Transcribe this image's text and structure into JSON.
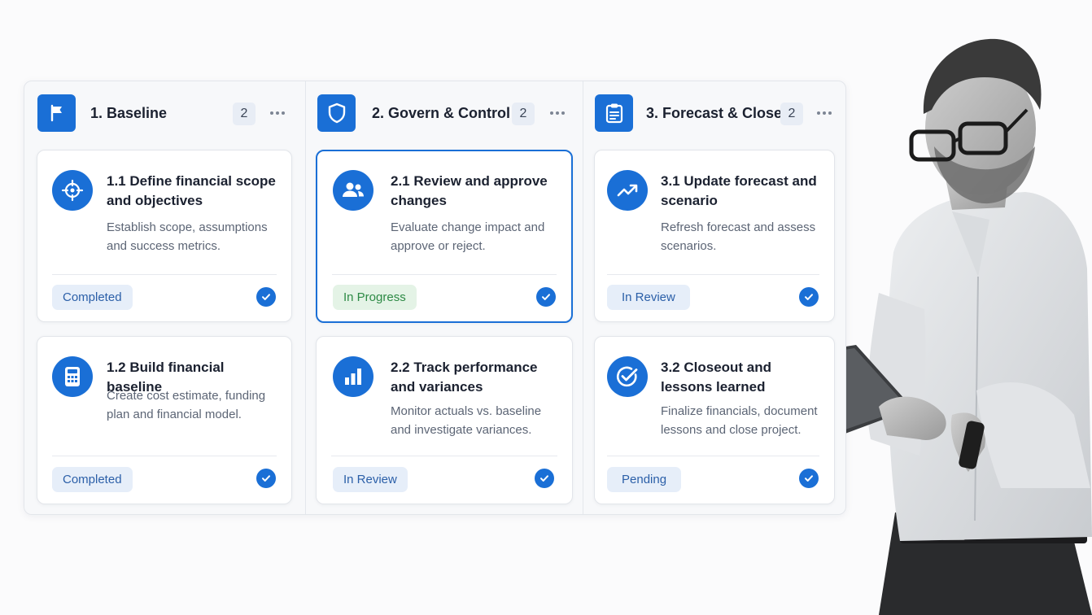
{
  "columns": [
    {
      "title": "1. Baseline",
      "count": "2",
      "icon": "flag-icon",
      "cards": [
        {
          "title": "1.1 Define financial scope and objectives",
          "description": "Establish scope, assumptions and success metrics.",
          "status": "Completed",
          "icon": "target-icon"
        },
        {
          "title": "1.2 Build financial baseline",
          "description": "Create cost estimate, funding plan and financial model.",
          "status": "Completed",
          "icon": "calculator-icon"
        }
      ]
    },
    {
      "title": "2. Govern & Control",
      "count": "2",
      "icon": "shield-icon",
      "cards": [
        {
          "title": "2.1 Review and approve changes",
          "description": "Evaluate change impact and approve or reject.",
          "status": "In Progress",
          "icon": "users-icon"
        },
        {
          "title": "2.2 Track performance and variances",
          "description": "Monitor actuals vs. baseline and investigate variances.",
          "status": "In Review",
          "icon": "bar-chart-icon"
        }
      ]
    },
    {
      "title": "3. Forecast & Close",
      "count": "2",
      "icon": "clipboard-icon",
      "cards": [
        {
          "title": "3.1 Update forecast and scenario",
          "description": "Refresh forecast and assess scenarios.",
          "status": "In Review",
          "icon": "trend-up-icon"
        },
        {
          "title": "3.2 Closeout and lessons learned",
          "description": "Finalize financials, document lessons and close project.",
          "status": "Pending",
          "icon": "check-circle-icon"
        }
      ]
    }
  ],
  "colors": {
    "accent": "#1a6fd6",
    "status_blue_bg": "#e6eef9",
    "status_green_bg": "#e4f3e6"
  }
}
